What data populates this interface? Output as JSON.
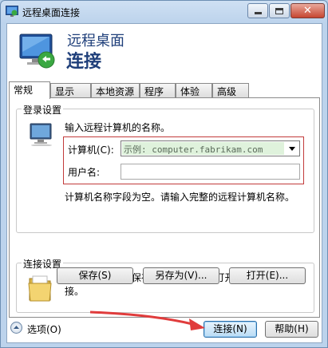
{
  "window": {
    "title": "远程桌面连接"
  },
  "header": {
    "line1": "远程桌面",
    "line2": "连接"
  },
  "tabs": [
    {
      "label": "常规"
    },
    {
      "label": "显示"
    },
    {
      "label": "本地资源"
    },
    {
      "label": "程序"
    },
    {
      "label": "体验"
    },
    {
      "label": "高级"
    }
  ],
  "login": {
    "group_title": "登录设置",
    "prompt": "输入远程计算机的名称。",
    "computer_label": "计算机(C):",
    "computer_placeholder": "示例: computer.fabrikam.com",
    "user_label": "用户名:",
    "user_value": "",
    "hint": "计算机名称字段为空。请输入完整的远程计算机名称。"
  },
  "connection": {
    "group_title": "连接设置",
    "description": "将当前连接设置保存到 RDP 文件或打开一个已保存的连接。",
    "save_label": "保存(S)",
    "saveas_label": "另存为(V)...",
    "open_label": "打开(E)..."
  },
  "footer": {
    "options_label": "选项(O)",
    "connect_label": "连接(N)",
    "help_label": "帮助(H)"
  },
  "colors": {
    "accent": "#1f3f7a",
    "highlight_border": "#c23b3b",
    "annotation_arrow": "#e03c3c"
  }
}
